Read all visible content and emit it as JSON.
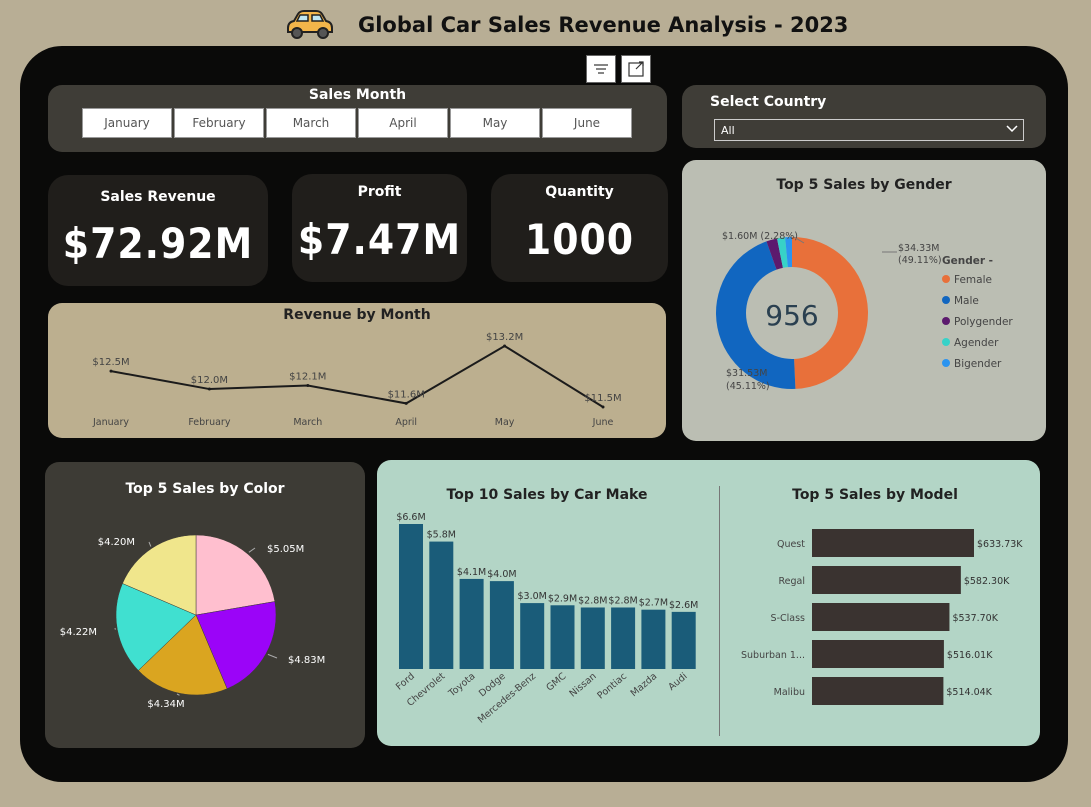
{
  "header": {
    "title": "Global Car Sales Revenue Analysis - 2023",
    "icon": "car-icon"
  },
  "toolbar": {
    "filter_icon": "filter-icon",
    "focus_icon": "focus-mode-icon"
  },
  "month_slicer": {
    "title": "Sales Month",
    "months": [
      "January",
      "February",
      "March",
      "April",
      "May",
      "June"
    ]
  },
  "country_slicer": {
    "title": "Select Country",
    "selected": "All"
  },
  "kpis": {
    "revenue": {
      "label": "Sales Revenue",
      "value": "$72.92M"
    },
    "profit": {
      "label": "Profit",
      "value": "$7.47M"
    },
    "quantity": {
      "label": "Quantity",
      "value": "1000"
    }
  },
  "colors": {
    "background": "#b8ae95",
    "dashboard": "#0a0a09",
    "bar": "#1a5c79",
    "model_bar": "#3a3330"
  },
  "chart_data": [
    {
      "id": "revenue-by-month",
      "type": "line",
      "title": "Revenue by Month",
      "categories": [
        "January",
        "February",
        "March",
        "April",
        "May",
        "June"
      ],
      "values": [
        12.5,
        12.0,
        12.1,
        11.6,
        13.2,
        11.5
      ],
      "labels": [
        "$12.5M",
        "$12.0M",
        "$12.1M",
        "$11.6M",
        "$13.2M",
        "$11.5M"
      ],
      "ylim": [
        11.0,
        13.5
      ]
    },
    {
      "id": "sales-by-gender",
      "type": "pie",
      "title": "Top 5 Sales by Gender",
      "legend_title": "Gender -",
      "center_value": "956",
      "categories": [
        "Female",
        "Male",
        "Polygender",
        "Agender",
        "Bigender"
      ],
      "values": [
        34.33,
        31.53,
        1.6,
        1.2,
        1.0
      ],
      "slice_colors": [
        "#e8703a",
        "#1166c0",
        "#5c1a6e",
        "#37d2c8",
        "#2b94f0"
      ],
      "labels": [
        {
          "value": "$34.33M",
          "pct": "(49.11%)"
        },
        {
          "value": "$31.53M",
          "pct": "(45.11%)"
        },
        {
          "value": "$1.60M (2.28%)",
          "pct": ""
        }
      ]
    },
    {
      "id": "sales-by-color",
      "type": "pie",
      "title": "Top 5 Sales by Color",
      "values": [
        5.05,
        4.83,
        4.34,
        4.22,
        4.2
      ],
      "labels": [
        "$5.05M",
        "$4.83M",
        "$4.34M",
        "$4.22M",
        "$4.20M"
      ],
      "slice_colors": [
        "#ffbfcf",
        "#9b04f8",
        "#daa520",
        "#40e0d0",
        "#f0e68c"
      ]
    },
    {
      "id": "sales-by-make",
      "type": "bar",
      "title": "Top 10 Sales by Car Make",
      "categories": [
        "Ford",
        "Chevrolet",
        "Toyota",
        "Dodge",
        "Mercedes-Benz",
        "GMC",
        "Nissan",
        "Pontiac",
        "Mazda",
        "Audi"
      ],
      "values": [
        6.6,
        5.8,
        4.1,
        4.0,
        3.0,
        2.9,
        2.8,
        2.8,
        2.7,
        2.6
      ],
      "labels": [
        "$6.6M",
        "$5.8M",
        "$4.1M",
        "$4.0M",
        "$3.0M",
        "$2.9M",
        "$2.8M",
        "$2.8M",
        "$2.7M",
        "$2.6M"
      ]
    },
    {
      "id": "sales-by-model",
      "type": "bar",
      "title": "Top 5 Sales by Model",
      "categories": [
        "Quest",
        "Regal",
        "S-Class",
        "Suburban 1...",
        "Malibu"
      ],
      "values": [
        633.73,
        582.3,
        537.7,
        516.01,
        514.04
      ],
      "labels": [
        "$633.73K",
        "$582.30K",
        "$537.70K",
        "$516.01K",
        "$514.04K"
      ]
    }
  ]
}
